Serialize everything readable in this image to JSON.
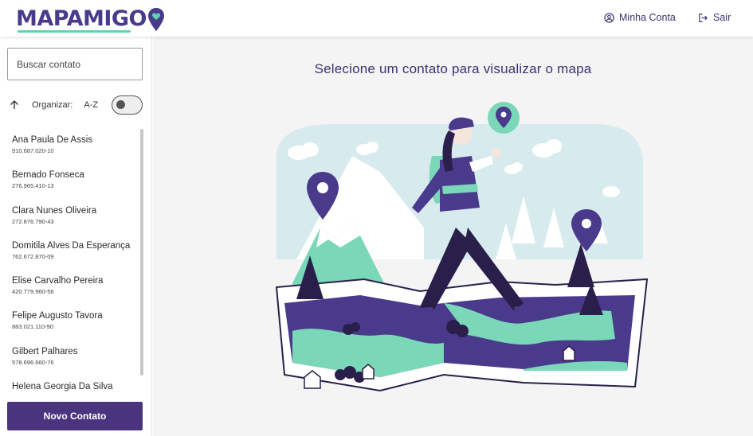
{
  "header": {
    "logo_text": "MAPAMIGO",
    "account_label": "Minha Conta",
    "logout_label": "Sair"
  },
  "sidebar": {
    "search_placeholder": "Buscar contato",
    "sort_label": "Organizar:",
    "sort_value": "A-Z",
    "toggle_on": false,
    "contacts": [
      {
        "name": "Ana Paula De Assis",
        "doc": "910.687.020-10"
      },
      {
        "name": "Bernado Fonseca",
        "doc": "276.965.410-13"
      },
      {
        "name": "Clara Nunes Oliveira",
        "doc": "272.876.790-43"
      },
      {
        "name": "Domitila Alves Da Esperança",
        "doc": "762.672.870-09"
      },
      {
        "name": "Elise Carvalho Pereira",
        "doc": "420.779.960-56"
      },
      {
        "name": "Felipe Augusto Tavora",
        "doc": "883.021.110-90"
      },
      {
        "name": "Gilbert Palhares",
        "doc": "578.696.660-76"
      },
      {
        "name": "Helena Georgia Da Silva",
        "doc": ""
      }
    ],
    "new_contact_label": "Novo Contato"
  },
  "main": {
    "title": "Selecione um contato para visualizar o mapa"
  },
  "colors": {
    "brand": "#4a3a8c",
    "accent": "#5fd3b0",
    "button": "#4a347e",
    "map_water": "#4a3a8c",
    "map_land": "#7ad8b8"
  },
  "icons": {
    "account": "user-circle-icon",
    "logout": "logout-arrow-icon",
    "sort": "arrow-up-icon",
    "logo_pin": "map-pin-heart-icon"
  }
}
